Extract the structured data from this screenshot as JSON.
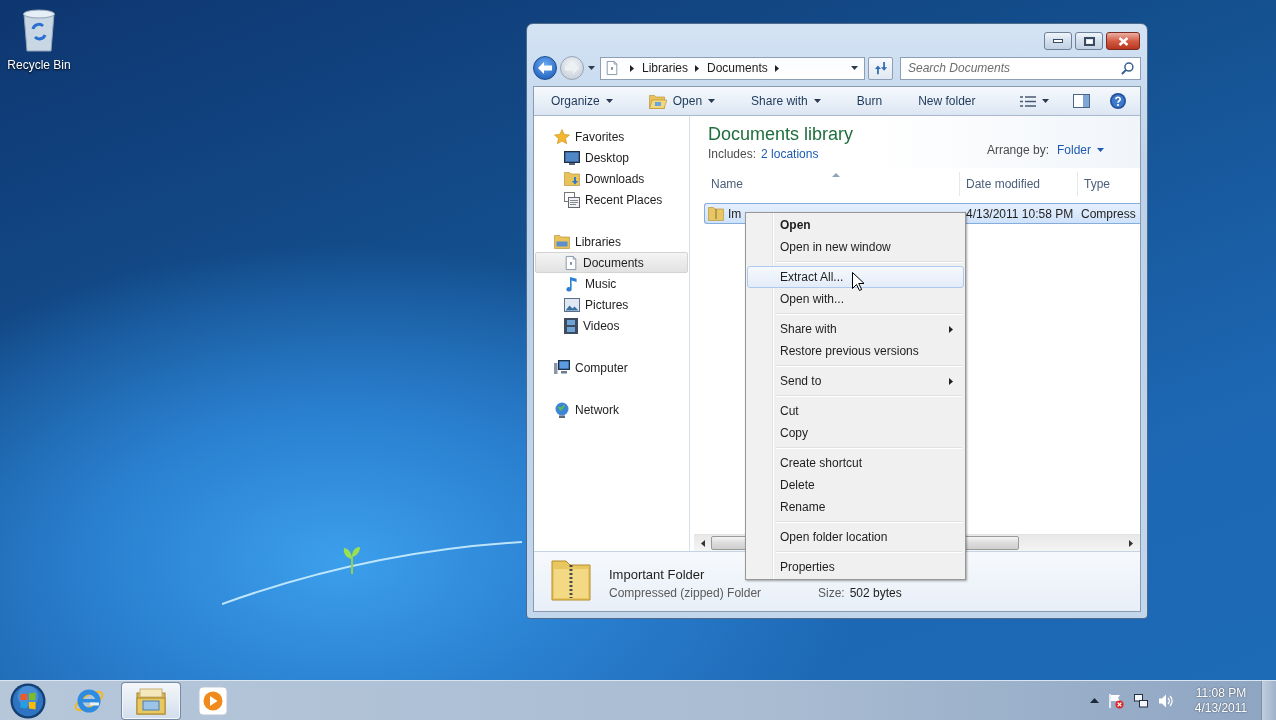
{
  "desktop": {
    "icons": [
      {
        "label": "Recycle Bin"
      }
    ]
  },
  "window": {
    "address": {
      "breadcrumbs": [
        "Libraries",
        "Documents"
      ]
    },
    "search": {
      "placeholder": "Search Documents"
    },
    "command_bar": [
      {
        "label": "Organize",
        "kind": "text",
        "dropdown": true
      },
      {
        "label": "Open",
        "kind": "icon-text",
        "dropdown": true
      },
      {
        "label": "Share with",
        "kind": "text",
        "dropdown": true
      },
      {
        "label": "Burn",
        "kind": "text",
        "dropdown": false
      },
      {
        "label": "New folder",
        "kind": "text",
        "dropdown": false
      }
    ],
    "sidebar": {
      "groups": [
        {
          "label": "Favorites",
          "kind": "favorites",
          "selected": false,
          "children": [
            {
              "label": "Desktop",
              "kind": "desktop",
              "selected": false
            },
            {
              "label": "Downloads",
              "kind": "downloads",
              "selected": false
            },
            {
              "label": "Recent Places",
              "kind": "recent",
              "selected": false
            }
          ]
        },
        {
          "label": "Libraries",
          "kind": "libraries",
          "selected": false,
          "children": [
            {
              "label": "Documents",
              "kind": "documents",
              "selected": true
            },
            {
              "label": "Music",
              "kind": "music",
              "selected": false
            },
            {
              "label": "Pictures",
              "kind": "pictures",
              "selected": false
            },
            {
              "label": "Videos",
              "kind": "videos",
              "selected": false
            }
          ]
        },
        {
          "label": "Computer",
          "kind": "computer",
          "selected": false
        },
        {
          "label": "Network",
          "kind": "network",
          "selected": false
        }
      ]
    },
    "library": {
      "title": "Documents library",
      "includes_label": "Includes:",
      "includes_link": "2 locations",
      "arrange_label": "Arrange by:",
      "arrange_value": "Folder"
    },
    "table": {
      "columns": [
        {
          "label": "Name",
          "sorted": true
        },
        {
          "label": "Date modified",
          "sorted": false
        },
        {
          "label": "Type",
          "sorted": false
        }
      ],
      "rows": [
        {
          "cells": [
            "Im",
            "4/13/2011 10:58 PM",
            "Compress"
          ],
          "selected": true
        }
      ]
    },
    "details": {
      "name": "Important Folder",
      "type": "Compressed (zipped) Folder",
      "size_label": "Size:",
      "size_value": "502 bytes"
    }
  },
  "context_menu": {
    "groups": [
      [
        {
          "label": "Open",
          "default": true,
          "highlighted": false,
          "submenu": false
        },
        {
          "label": "Open in new window",
          "default": false,
          "highlighted": false,
          "submenu": false
        }
      ],
      [
        {
          "label": "Extract All...",
          "default": false,
          "highlighted": true,
          "submenu": false
        },
        {
          "label": "Open with...",
          "default": false,
          "highlighted": false,
          "submenu": false
        }
      ],
      [
        {
          "label": "Share with",
          "default": false,
          "highlighted": false,
          "submenu": true
        },
        {
          "label": "Restore previous versions",
          "default": false,
          "highlighted": false,
          "submenu": false
        }
      ],
      [
        {
          "label": "Send to",
          "default": false,
          "highlighted": false,
          "submenu": true
        }
      ],
      [
        {
          "label": "Cut",
          "default": false,
          "highlighted": false,
          "submenu": false
        },
        {
          "label": "Copy",
          "default": false,
          "highlighted": false,
          "submenu": false
        }
      ],
      [
        {
          "label": "Create shortcut",
          "default": false,
          "highlighted": false,
          "submenu": false
        },
        {
          "label": "Delete",
          "default": false,
          "highlighted": false,
          "submenu": false
        },
        {
          "label": "Rename",
          "default": false,
          "highlighted": false,
          "submenu": false
        }
      ],
      [
        {
          "label": "Open folder location",
          "default": false,
          "highlighted": false,
          "submenu": false
        }
      ],
      [
        {
          "label": "Properties",
          "default": false,
          "highlighted": false,
          "submenu": false
        }
      ]
    ]
  },
  "taskbar": {
    "buttons": [
      {
        "kind": "browser",
        "selected": false
      },
      {
        "kind": "explorer",
        "selected": true
      },
      {
        "kind": "media",
        "selected": false
      }
    ],
    "clock": {
      "time": "11:08 PM",
      "date": "4/13/2011"
    }
  }
}
